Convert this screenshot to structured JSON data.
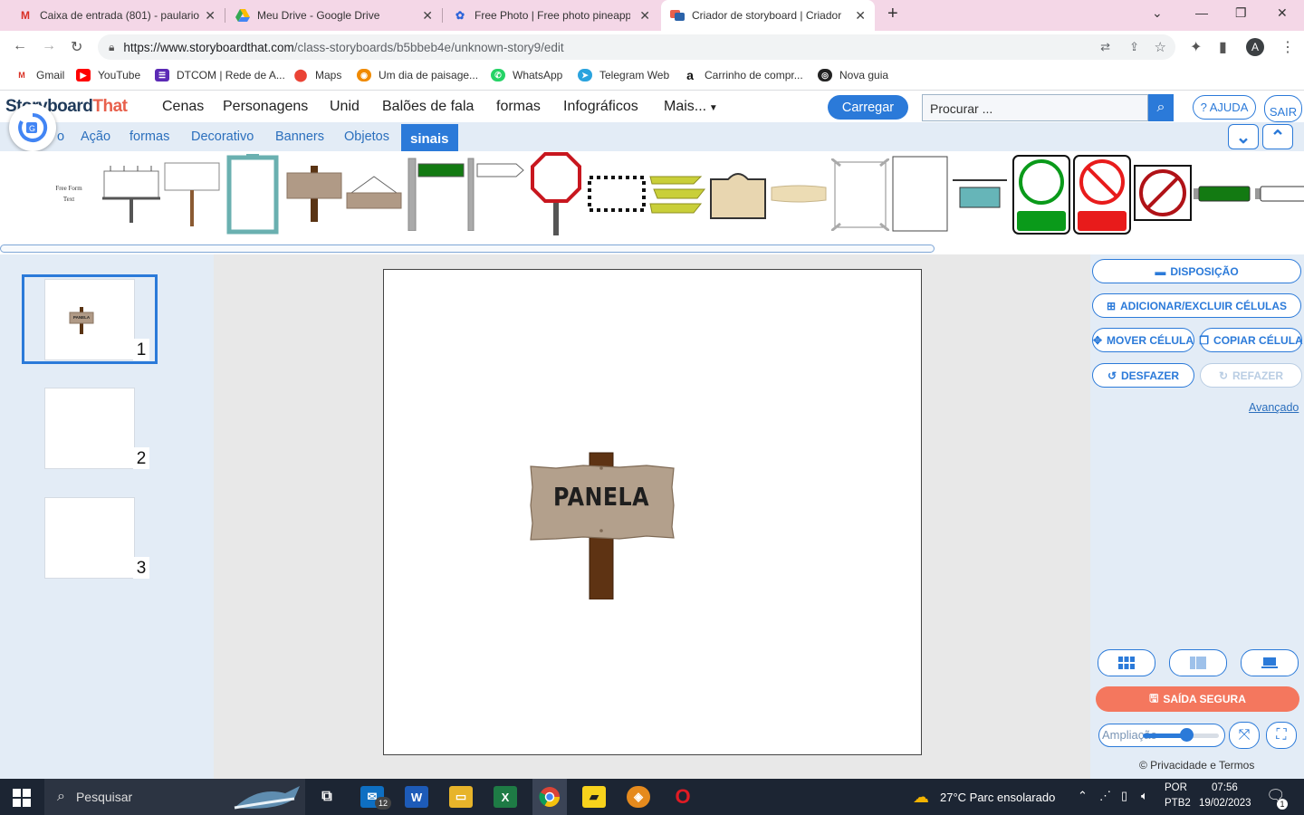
{
  "browser": {
    "tabs": [
      {
        "title": "Caixa de entrada (801) - paulario",
        "icon": "gmail-icon"
      },
      {
        "title": "Meu Drive - Google Drive",
        "icon": "drive-icon"
      },
      {
        "title": "Free Photo | Free photo pineappl",
        "icon": "freepik-icon"
      },
      {
        "title": "Criador de storyboard | Criador d",
        "icon": "storyboard-icon"
      }
    ],
    "new_tab": "+",
    "url_host": "https://www.storyboardthat.com",
    "url_path": "/class-storyboards/b5bbeb4e/unknown-story9/edit",
    "profile_initial": "A",
    "bookmarks": [
      "Gmail",
      "YouTube",
      "DTCOM | Rede de A...",
      "Maps",
      "Um dia de paisage...",
      "WhatsApp",
      "Telegram Web",
      "Carrinho de compr...",
      "Nova guia"
    ]
  },
  "app": {
    "logo_part1": "Storyboard",
    "logo_part2": "That",
    "menu": [
      "Cenas",
      "Personagens",
      "Unid",
      "Balões de fala",
      "formas",
      "Infográficos",
      "Mais..."
    ],
    "upload_label": "Carregar",
    "search_placeholder": "Procurar ...",
    "help_label": "? AJUDA",
    "exit_label": "SAIR",
    "categories": [
      "Ação",
      "formas",
      "Decorativo",
      "Banners",
      "Objetos",
      "sinais"
    ],
    "cat_partial": "o",
    "library_first_text": "Free Form Text",
    "cells": [
      "1",
      "2",
      "3"
    ],
    "canvas_sign_text": "PANELA",
    "thumb_sign_text": "PANELA",
    "right": {
      "layout": "DISPOSIÇÃO",
      "add_cells": "ADICIONAR/EXCLUIR CÉLULAS",
      "move_cell": "MOVER CÉLULA",
      "copy_cell": "COPIAR CÉLULA",
      "undo": "DESFAZER",
      "redo": "REFAZER",
      "advanced": "Avançado",
      "save": "SAÍDA SEGURA",
      "zoom_label": "Ampliação",
      "zoom_level": 0.57,
      "privacy": "© Privacidade e Termos"
    }
  },
  "taskbar": {
    "search": "Pesquisar",
    "mail_badge": "12",
    "weather": "27°C  Parc ensolarado",
    "lang": "POR",
    "layout": "PTB2",
    "time": "07:56",
    "date": "19/02/2023",
    "notif": "1"
  },
  "colors": {
    "accent": "#2b7ad9",
    "save": "#f4775e",
    "panel": "#e3ecf6"
  }
}
